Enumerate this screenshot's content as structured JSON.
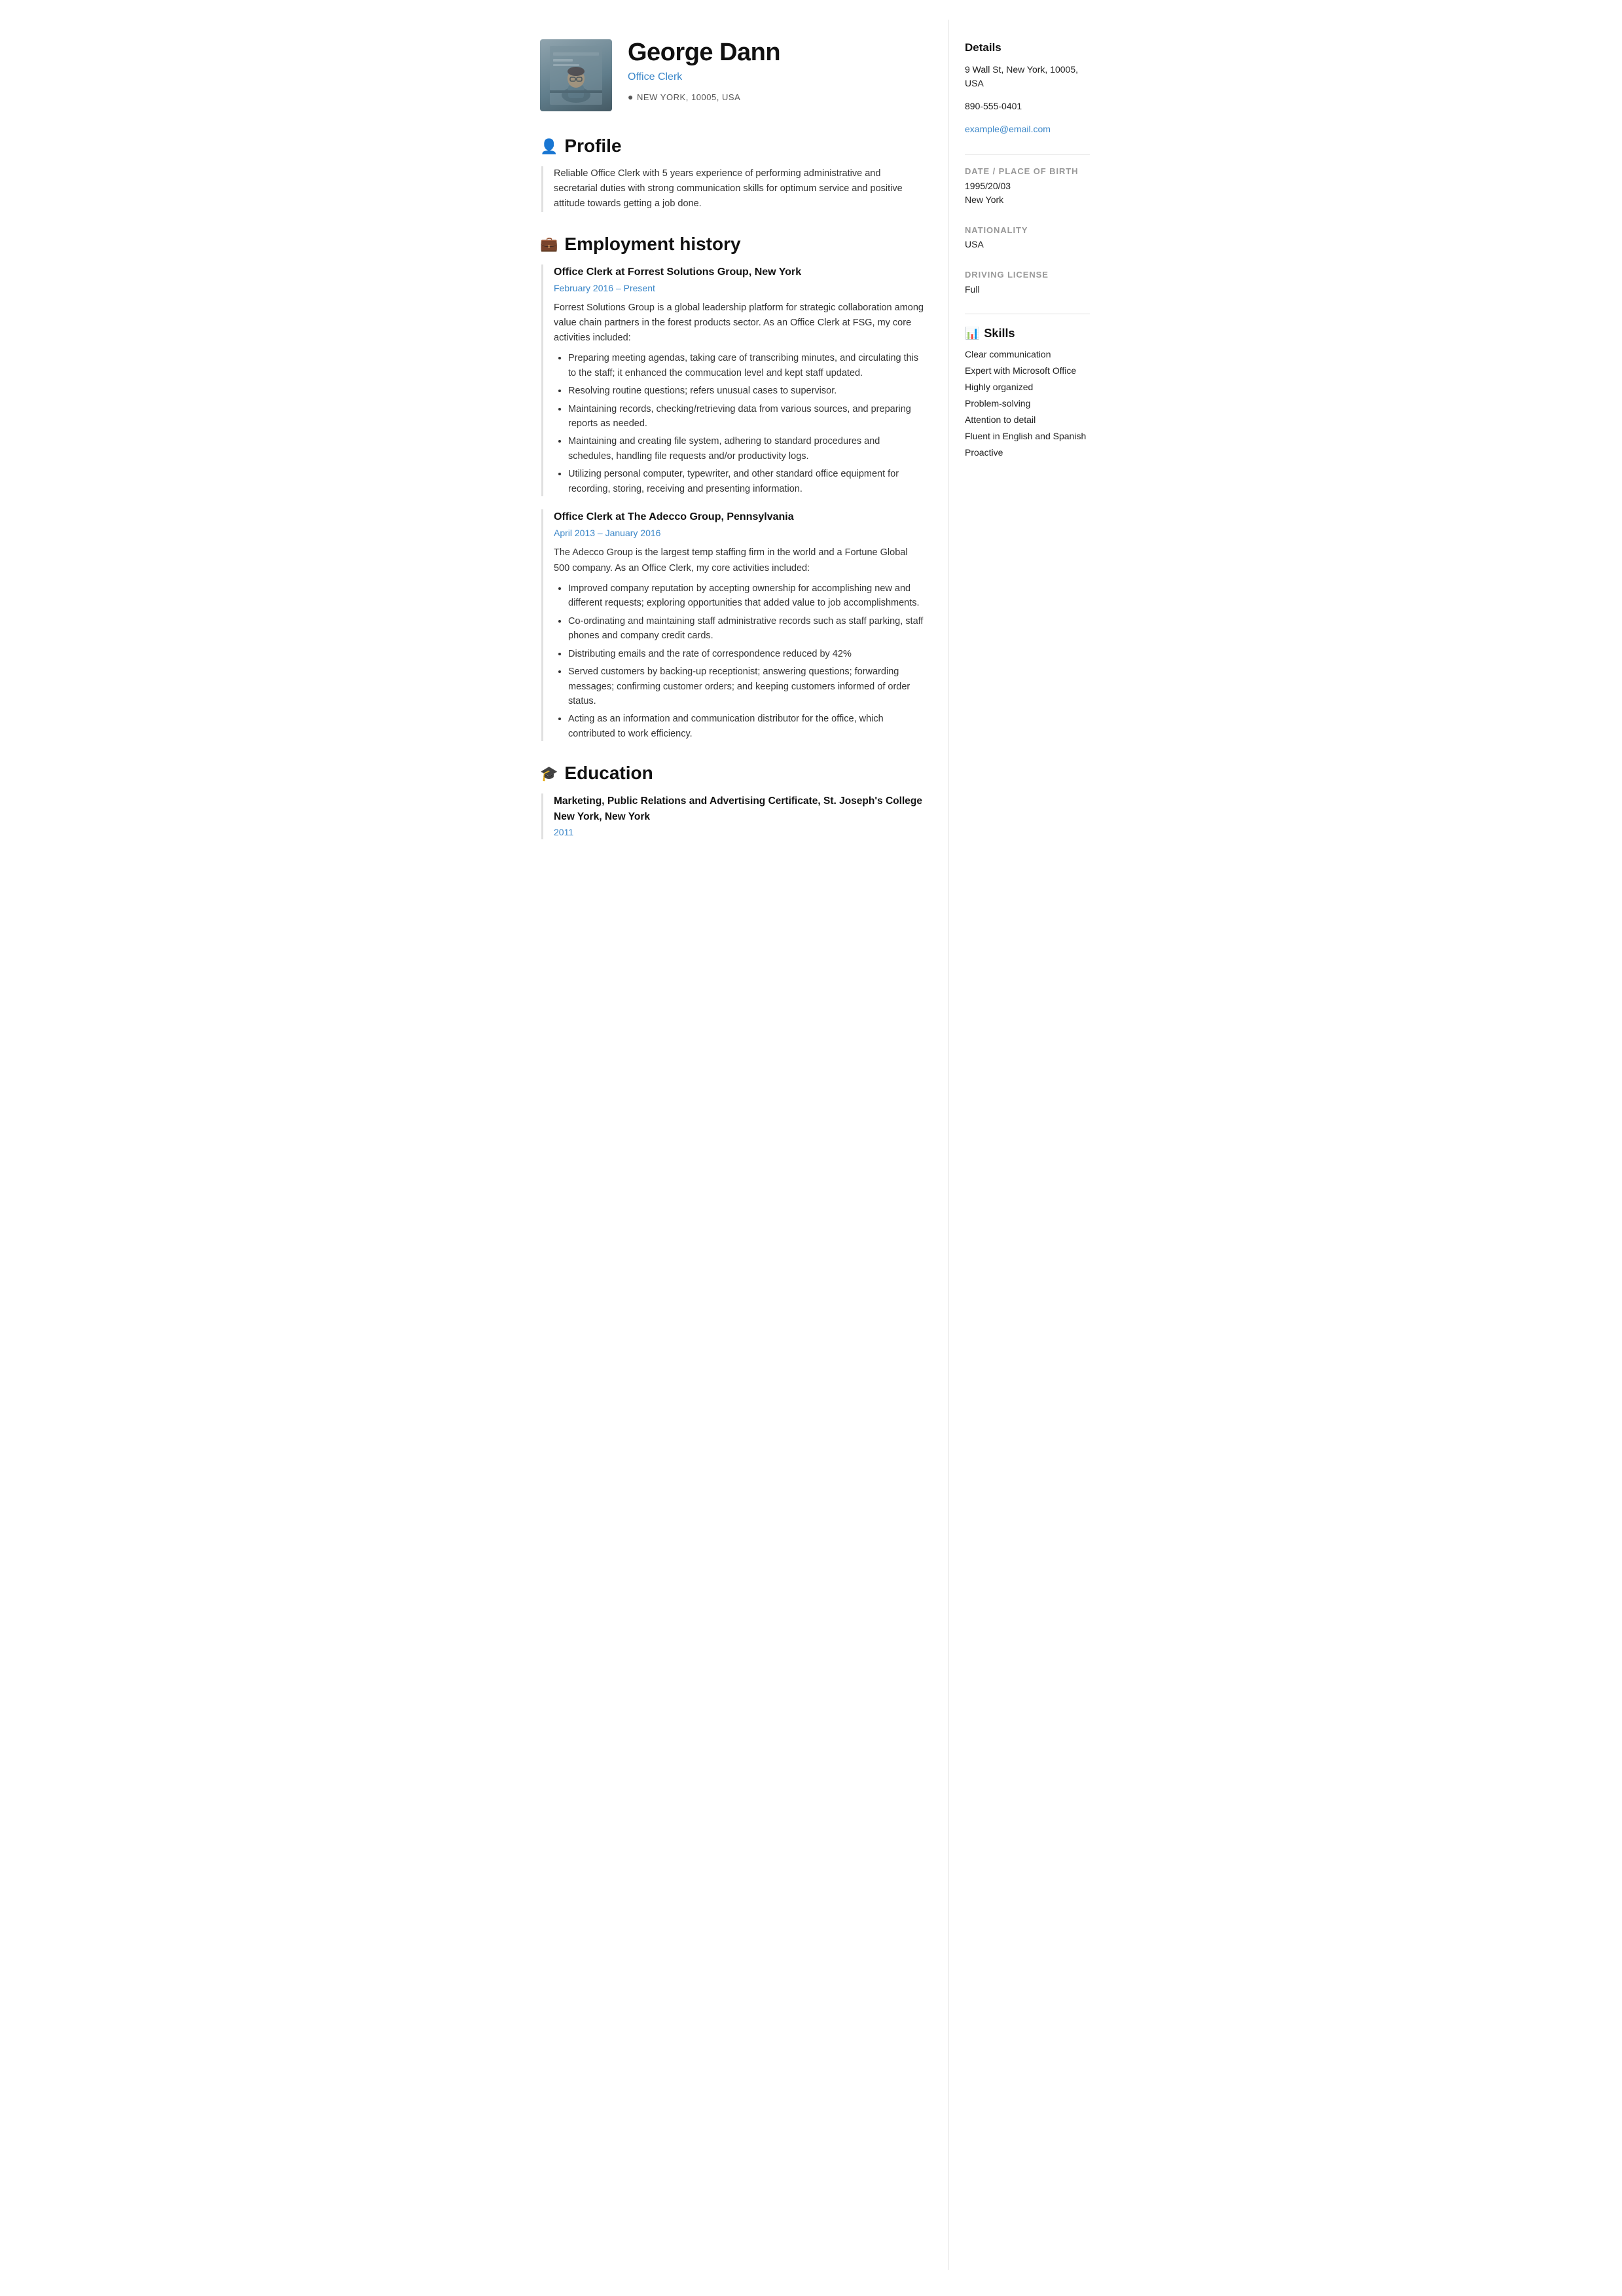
{
  "header": {
    "name": "George Dann",
    "title": "Office Clerk",
    "location": "NEW YORK, 10005, USA"
  },
  "profile": {
    "section_title": "Profile",
    "text": "Reliable Office Clerk with 5 years experience of performing administrative and secretarial duties with strong communication skills for optimum service and positive attitude towards getting a job done."
  },
  "employment": {
    "section_title": "Employment history",
    "jobs": [
      {
        "title": "Office Clerk at Forrest Solutions Group, New York",
        "dates": "February 2016  –  Present",
        "description": "Forrest Solutions Group is a global leadership platform for strategic collaboration among value chain partners in the forest products sector. As an Office Clerk at FSG, my core activities included:",
        "bullets": [
          "Preparing meeting agendas, taking  care of transcribing minutes, and circulating this to the staff; it enhanced the commucation level and kept staff updated.",
          "Resolving  routine questions; refers unusual cases to supervisor.",
          "Maintaining records, checking/retrieving data from various sources, and preparing reports as needed.",
          "Maintaining and creating file system, adhering to standard procedures and schedules, handling file requests and/or productivity logs.",
          "Utilizing personal computer, typewriter, and other standard office equipment for recording, storing, receiving and presenting information."
        ]
      },
      {
        "title": "Office Clerk at The Adecco Group, Pennsylvania",
        "dates": "April 2013  –  January 2016",
        "description": "The Adecco Group is the largest temp staffing firm in the world and a Fortune Global 500 company. As an Office Clerk, my core activities included:",
        "bullets": [
          " Improved company reputation by accepting ownership for accomplishing new and different requests; exploring opportunities that added value to job accomplishments.",
          "Co-ordinating and maintaining staff administrative records such as staff parking, staff phones and company credit cards.",
          "Distributing emails and the rate of correspondence reduced by 42%",
          "Served customers by backing-up receptionist; answering questions; forwarding messages; confirming customer orders; and keeping customers informed of order status.",
          "Acting as an information and communication distributor for the office, which contributed to work efficiency."
        ]
      }
    ]
  },
  "education": {
    "section_title": "Education",
    "entries": [
      {
        "degree": "Marketing, Public Relations and Advertising Certificate, St. Joseph's College New York, New York",
        "year": "2011"
      }
    ]
  },
  "sidebar": {
    "details_title": "Details",
    "address": "9 Wall St, New York, 10005, USA",
    "phone": "890-555-0401",
    "email": "example@email.com",
    "dob_label": "DATE / PLACE OF BIRTH",
    "dob_value": "1995/20/03",
    "dob_place": "New York",
    "nationality_label": "NATIONALITY",
    "nationality_value": "USA",
    "driving_label": "DRIVING LICENSE",
    "driving_value": "Full",
    "skills_title": "Skills",
    "skills": [
      "Clear communication",
      "Expert with Microsoft Office",
      "Highly organized",
      "Problem-solving",
      "Attention to detail",
      "Fluent in English and Spanish",
      "Proactive"
    ]
  }
}
